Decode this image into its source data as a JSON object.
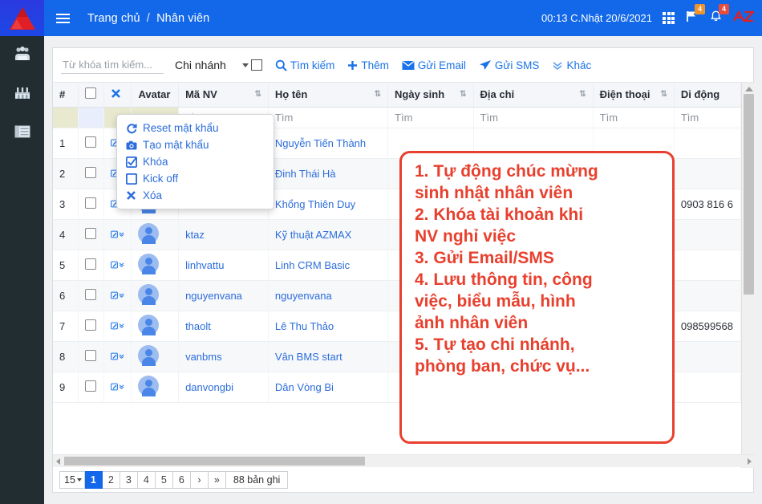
{
  "topbar": {
    "logo_icon": "az-triangle-logo",
    "menu_icon": "hamburger-icon",
    "breadcrumb_home": "Trang chủ",
    "breadcrumb_sep": "/",
    "breadcrumb_current": "Nhân viên",
    "clock": "00:13  C.Nhật 20/6/2021",
    "apps_icon": "grid-apps-icon",
    "flag_icon": "flag-icon",
    "flag_badge": "4",
    "bell_icon": "bell-icon",
    "bell_badge": "4",
    "brand_mark": "AZ",
    "bg_color": "#1268e8"
  },
  "sidebar": {
    "items": [
      {
        "icon": "users-group-icon",
        "name": "sidebar-item-employees"
      },
      {
        "icon": "factory-building-icon",
        "name": "sidebar-item-branches"
      },
      {
        "icon": "list-table-icon",
        "name": "sidebar-item-records"
      }
    ],
    "bg_color": "#222d32"
  },
  "toolbar": {
    "search_placeholder": "Từ khóa tìm kiếm...",
    "search_value": "",
    "branch_label": "Chi nhánh",
    "buttons": [
      {
        "label": "Tìm kiếm",
        "icon": "search-icon"
      },
      {
        "label": "Thêm",
        "icon": "plus-icon"
      },
      {
        "label": "Gửi Email",
        "icon": "envelope-icon"
      },
      {
        "label": "Gửi SMS",
        "icon": "paper-plane-icon"
      },
      {
        "label": "Khác",
        "icon": "chevron-double-down-icon"
      }
    ],
    "link_color": "#1a73e8"
  },
  "table": {
    "headers": [
      {
        "label": "#",
        "sortable": false
      },
      {
        "label": "",
        "sortable": false
      },
      {
        "label": "",
        "sortable": false
      },
      {
        "label": "Avatar",
        "sortable": false
      },
      {
        "label": "Mã NV",
        "sortable": true
      },
      {
        "label": "Họ tên",
        "sortable": true
      },
      {
        "label": "Ngày sinh",
        "sortable": true
      },
      {
        "label": "Địa chỉ",
        "sortable": true
      },
      {
        "label": "Điện thoại",
        "sortable": true
      },
      {
        "label": "Di động",
        "sortable": false
      }
    ],
    "select_all_icon": "checkbox-icon",
    "clear_icon": "x-clear-icon",
    "filter_placeholder": "Tìm",
    "rows": [
      {
        "no": "1",
        "ma_nv": "",
        "ho_ten": "Nguyễn Tiến Thành",
        "ngay_sinh": "",
        "dia_chi": "",
        "dien_thoai": "",
        "di_dong": ""
      },
      {
        "no": "2",
        "ma_nv": "",
        "ho_ten": "Đinh Thái Hà",
        "ngay_sinh": "",
        "dia_chi": "",
        "dien_thoai": "",
        "di_dong": ""
      },
      {
        "no": "3",
        "ma_nv": "",
        "ho_ten": "Khổng Thiên Duy",
        "ngay_sinh": "",
        "dia_chi": "",
        "dien_thoai": "",
        "di_dong": "0903 816 6"
      },
      {
        "no": "4",
        "ma_nv": "ktaz",
        "ho_ten": "Kỹ thuật AZMAX",
        "ngay_sinh": "",
        "dia_chi": "",
        "dien_thoai": "",
        "di_dong": ""
      },
      {
        "no": "5",
        "ma_nv": "linhvattu",
        "ho_ten": "Linh CRM Basic",
        "ngay_sinh": "",
        "dia_chi": "",
        "dien_thoai": "",
        "di_dong": ""
      },
      {
        "no": "6",
        "ma_nv": "nguyenvana",
        "ho_ten": "nguyenvana",
        "ngay_sinh": "",
        "dia_chi": "",
        "dien_thoai": "",
        "di_dong": ""
      },
      {
        "no": "7",
        "ma_nv": "thaolt",
        "ho_ten": "Lê Thu Thảo",
        "ngay_sinh": "",
        "dia_chi": "",
        "dien_thoai": "",
        "di_dong": "098599568"
      },
      {
        "no": "8",
        "ma_nv": "vanbms",
        "ho_ten": "Vân BMS start",
        "ngay_sinh": "",
        "dia_chi": "",
        "dien_thoai": "",
        "di_dong": ""
      },
      {
        "no": "9",
        "ma_nv": "danvongbi",
        "ho_ten": "Dân Vòng Bi",
        "ngay_sinh": "",
        "dia_chi": "",
        "dien_thoai": "",
        "di_dong": ""
      }
    ]
  },
  "context_menu": {
    "items": [
      {
        "label": "Reset mật khẩu",
        "icon": "refresh-icon"
      },
      {
        "label": "Tạo mật khẩu",
        "icon": "camera-icon"
      },
      {
        "label": "Khóa",
        "icon": "checked-box-icon"
      },
      {
        "label": "Kick off",
        "icon": "empty-box-icon"
      },
      {
        "label": "Xóa",
        "icon": "x-icon"
      }
    ]
  },
  "annotation": {
    "color": "#e8402e",
    "lines": [
      "1. Tự động chúc mừng",
      "sinh nhật nhân viên",
      "2. Khóa tài khoản khi",
      "NV nghỉ việc",
      "3. Gửi Email/SMS",
      "4. Lưu thông tin, công",
      "việc, biểu mẫu, hình",
      "ảnh nhân viên",
      "5. Tự tạo chi nhánh,",
      "phòng ban, chức vụ..."
    ]
  },
  "pager": {
    "page_size": "15",
    "pages": [
      "1",
      "2",
      "3",
      "4",
      "5",
      "6"
    ],
    "active_page": "1",
    "next_label": "›",
    "last_label": "»",
    "total_label": "88 bản ghi"
  }
}
